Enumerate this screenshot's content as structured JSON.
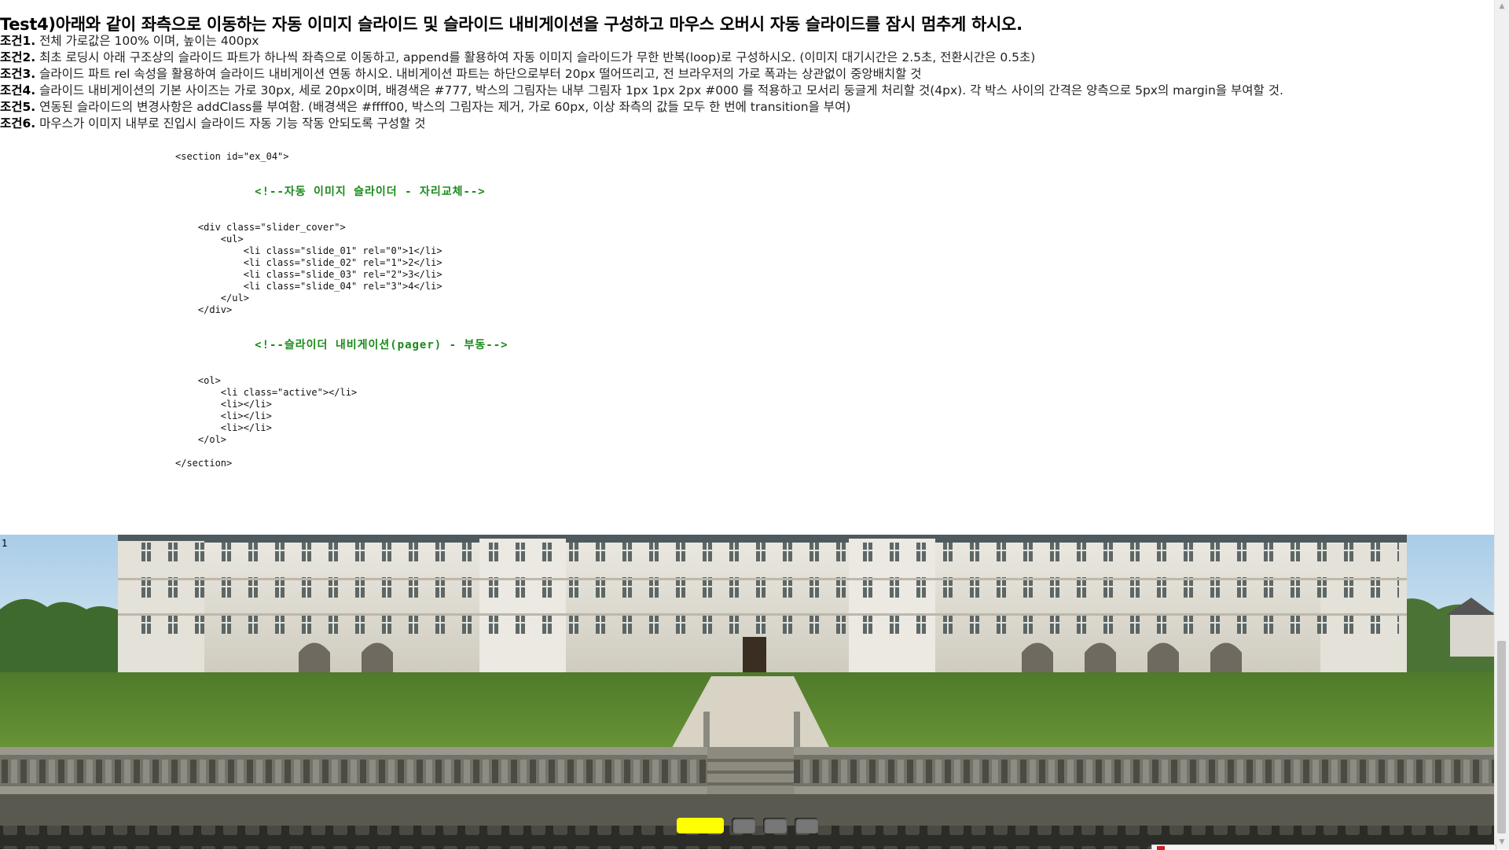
{
  "title": "Test4)아래와 같이 좌측으로 이동하는 자동 이미지 슬라이드 및 슬라이드 내비게이션을 구성하고 마우스 오버시 자동 슬라이드를 잠시 멈추게 하시오.",
  "conditions": [
    {
      "label": "조건1.",
      "text": " 전체 가로값은 100% 이며, 높이는 400px"
    },
    {
      "label": "조건2.",
      "text": " 최초 로딩시 아래 구조상의 슬라이드 파트가 하나씩 좌측으로 이동하고, append를 활용하여 자동 이미지 슬라이드가 무한 반복(loop)로 구성하시오. (이미지 대기시간은 2.5초, 전환시간은 0.5초)"
    },
    {
      "label": "조건3.",
      "text": " 슬라이드 파트 rel 속성을 활용하여 슬라이드 내비게이션 연동 하시오. 내비게이션 파트는 하단으로부터 20px 떨어뜨리고, 전 브라우저의 가로 폭과는 상관없이 중앙배치할 것"
    },
    {
      "label": "조건4.",
      "text": " 슬라이드 내비게이션의 기본 사이즈는 가로 30px, 세로 20px이며, 배경색은 #777, 박스의 그림자는 내부 그림자 1px 1px 2px #000 를 적용하고 모서리 둥글게 처리할 것(4px). 각 박스 사이의 간격은 양측으로 5px의 margin을 부여할 것."
    },
    {
      "label": "조건5.",
      "text": " 연동된 슬라이드의 변경사항은 addClass를 부여함. (배경색은 #ffff00, 박스의 그림자는 제거, 가로 60px, 이상 좌측의 값들 모두 한 번에 transition을 부여)"
    },
    {
      "label": "조건6.",
      "text": " 마우스가 이미지 내부로 진입시 슬라이드 자동 기능 작동 안되도록 구성할 것"
    }
  ],
  "code": {
    "section_open": "<section id=\"ex_04\">",
    "comment1": "<!--자동 이미지 슬라이더 - 자리교체-->",
    "div_open": "<div class=\"slider_cover\">",
    "ul_open": "<ul>",
    "slides": [
      "<li class=\"slide_01\" rel=\"0\">1</li>",
      "<li class=\"slide_02\" rel=\"1\">2</li>",
      "<li class=\"slide_03\" rel=\"2\">3</li>",
      "<li class=\"slide_04\" rel=\"3\">4</li>"
    ],
    "ul_close": "</ul>",
    "div_close": "</div>",
    "comment2": "<!--슬라이더 내비게이션(pager) - 부동-->",
    "ol_open": "<ol>",
    "pager_items": [
      "<li class=\"active\"></li>",
      "<li></li>",
      "<li></li>",
      "<li></li>"
    ],
    "ol_close": "</ol>",
    "section_close": "</section>"
  },
  "slider": {
    "current_slide_label": "1",
    "active_index": 0,
    "pager_count": 4
  },
  "colors": {
    "pager_default": "#777777",
    "pager_active": "#ffff00",
    "comment_green": "#1a8a1a"
  }
}
